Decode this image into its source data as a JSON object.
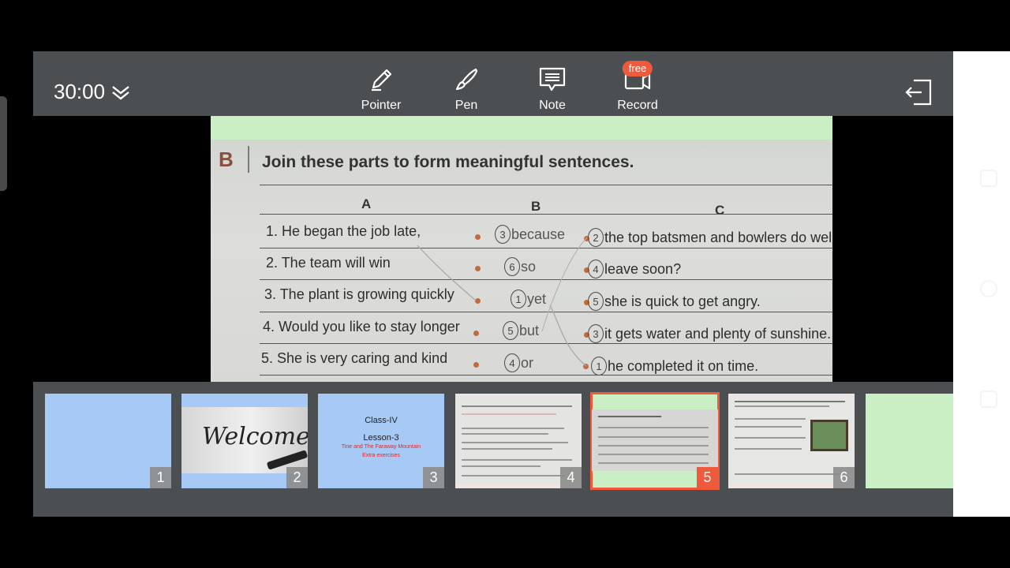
{
  "toolbar": {
    "timer": "30:00",
    "tools": [
      {
        "label": "Pointer",
        "icon": "pencil-icon"
      },
      {
        "label": "Pen",
        "icon": "pen-brush-icon"
      },
      {
        "label": "Note",
        "icon": "note-icon"
      },
      {
        "label": "Record",
        "icon": "video-camera-icon",
        "badge": "free"
      }
    ],
    "exit_icon": "exit-icon"
  },
  "slide": {
    "section": "B",
    "instruction": "Join these parts to form meaningful sentences.",
    "columns": [
      "A",
      "B",
      "C"
    ],
    "rows": [
      {
        "a": "1.  He began the job late,",
        "b_num": "3",
        "b_word": "because",
        "c_num": "2",
        "c_text": "the top batsmen and bowlers do well."
      },
      {
        "a": "2.  The team will win",
        "b_num": "6",
        "b_word": "so",
        "c_num": "4",
        "c_text": "leave soon?"
      },
      {
        "a": "3.  The plant is growing quickly",
        "b_num": "1",
        "b_word": "yet",
        "c_num": "5",
        "c_text": "she is quick to get angry."
      },
      {
        "a": "4.  Would you like to stay longer",
        "b_num": "5",
        "b_word": "but",
        "c_num": "3",
        "c_text": "it gets water and plenty of sunshine."
      },
      {
        "a": "5.  She is very caring and kind",
        "b_num": "4",
        "b_word": "or",
        "c_num": "1",
        "c_text": "he completed it on time."
      }
    ]
  },
  "thumbnails": [
    {
      "num": "1"
    },
    {
      "num": "2",
      "text": "Welcome"
    },
    {
      "num": "3",
      "title": "Class-IV",
      "subtitle": "Lesson-3",
      "line1": "Tine and The Faraway Mountain",
      "line2": "Extra exercises"
    },
    {
      "num": "4"
    },
    {
      "num": "5",
      "active": true
    },
    {
      "num": "6"
    }
  ],
  "colors": {
    "toolbar_bg": "#4c4f52",
    "accent": "#ef5a3c",
    "slide_green": "#cbefc5",
    "thumb_blue": "#a6c9f5"
  }
}
